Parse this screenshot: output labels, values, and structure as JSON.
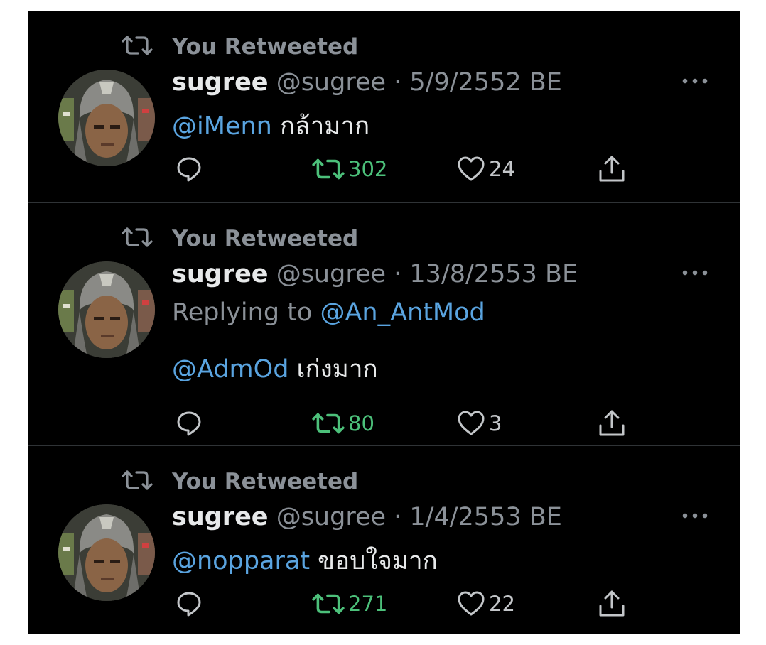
{
  "overlay": {
    "close_glyph": "×"
  },
  "tweets": [
    {
      "retweet_label": "You Retweeted",
      "name": "sugree",
      "handle": "@sugree",
      "separator": " · ",
      "date": "5/9/2552 BE",
      "replying_to": null,
      "mention": "@iMenn",
      "body": " กล้ามาก",
      "retweets": "302",
      "likes": "24"
    },
    {
      "retweet_label": "You Retweeted",
      "name": "sugree",
      "handle": "@sugree",
      "separator": " · ",
      "date": "13/8/2553 BE",
      "replying_to": {
        "prefix": "Replying to ",
        "user": "@An_AntMod"
      },
      "mention": "@AdmOd",
      "body": " เก่งมาก",
      "retweets": "80",
      "likes": "3"
    },
    {
      "retweet_label": "You Retweeted",
      "name": "sugree",
      "handle": "@sugree",
      "separator": " · ",
      "date": "1/4/2553 BE",
      "replying_to": null,
      "mention": "@nopparat",
      "body": " ขอบใจมาก",
      "retweets": "271",
      "likes": "22"
    }
  ],
  "colors": {
    "background": "#000000",
    "retweet_active": "#4cc07a",
    "mention": "#5aa4e0",
    "secondary_text": "#8b9198"
  },
  "icons": {
    "retweet": "retweet-icon",
    "more": "more-icon",
    "reply": "reply-icon",
    "like": "heart-icon",
    "share": "share-icon",
    "avatar": "avatar-photo"
  }
}
